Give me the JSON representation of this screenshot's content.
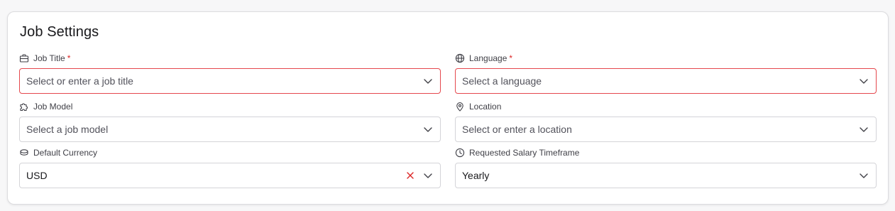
{
  "card": {
    "title": "Job Settings"
  },
  "fields": {
    "job_title": {
      "label": "Job Title",
      "required_mark": "*",
      "placeholder": "Select or enter a job title",
      "icon": "briefcase-icon"
    },
    "language": {
      "label": "Language",
      "required_mark": "*",
      "placeholder": "Select a language",
      "icon": "globe-icon"
    },
    "job_model": {
      "label": "Job Model",
      "placeholder": "Select a job model",
      "icon": "puzzle-icon"
    },
    "location": {
      "label": "Location",
      "placeholder": "Select or enter a location",
      "icon": "map-pin-icon"
    },
    "default_currency": {
      "label": "Default Currency",
      "value": "USD",
      "icon": "coins-icon"
    },
    "salary_timeframe": {
      "label": "Requested Salary Timeframe",
      "value": "Yearly",
      "icon": "clock-icon"
    }
  },
  "colors": {
    "error_border": "#e5484d",
    "required": "#dc2626",
    "clear_icon": "#dc2626"
  }
}
